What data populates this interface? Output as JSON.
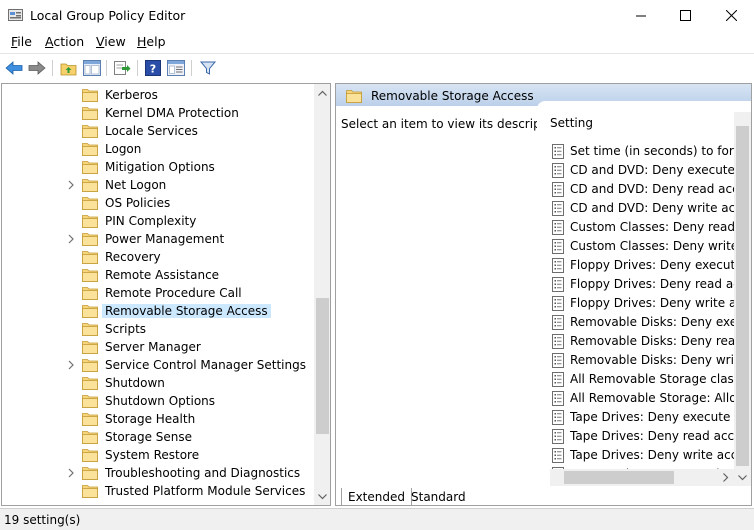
{
  "window": {
    "title": "Local Group Policy Editor",
    "controls": [
      "minimize",
      "maximize",
      "close"
    ]
  },
  "menu": {
    "items": [
      {
        "label": "File",
        "accel": "F"
      },
      {
        "label": "Action",
        "accel": "A"
      },
      {
        "label": "View",
        "accel": "V"
      },
      {
        "label": "Help",
        "accel": "H"
      }
    ]
  },
  "toolbar": {
    "icons": [
      "back-arrow-icon",
      "forward-arrow-icon",
      "up-folder-icon",
      "show-hide-tree-icon",
      "export-list-icon",
      "help-icon",
      "properties-icon",
      "filter-icon"
    ]
  },
  "tree": {
    "items": [
      {
        "label": "Kerberos",
        "expandable": false,
        "selected": false
      },
      {
        "label": "Kernel DMA Protection",
        "expandable": false,
        "selected": false
      },
      {
        "label": "Locale Services",
        "expandable": false,
        "selected": false
      },
      {
        "label": "Logon",
        "expandable": false,
        "selected": false
      },
      {
        "label": "Mitigation Options",
        "expandable": false,
        "selected": false
      },
      {
        "label": "Net Logon",
        "expandable": true,
        "selected": false
      },
      {
        "label": "OS Policies",
        "expandable": false,
        "selected": false
      },
      {
        "label": "PIN Complexity",
        "expandable": false,
        "selected": false
      },
      {
        "label": "Power Management",
        "expandable": true,
        "selected": false
      },
      {
        "label": "Recovery",
        "expandable": false,
        "selected": false
      },
      {
        "label": "Remote Assistance",
        "expandable": false,
        "selected": false
      },
      {
        "label": "Remote Procedure Call",
        "expandable": false,
        "selected": false
      },
      {
        "label": "Removable Storage Access",
        "expandable": false,
        "selected": true
      },
      {
        "label": "Scripts",
        "expandable": false,
        "selected": false
      },
      {
        "label": "Server Manager",
        "expandable": false,
        "selected": false
      },
      {
        "label": "Service Control Manager Settings",
        "expandable": true,
        "selected": false
      },
      {
        "label": "Shutdown",
        "expandable": false,
        "selected": false
      },
      {
        "label": "Shutdown Options",
        "expandable": false,
        "selected": false
      },
      {
        "label": "Storage Health",
        "expandable": false,
        "selected": false
      },
      {
        "label": "Storage Sense",
        "expandable": false,
        "selected": false
      },
      {
        "label": "System Restore",
        "expandable": false,
        "selected": false
      },
      {
        "label": "Troubleshooting and Diagnostics",
        "expandable": true,
        "selected": false
      },
      {
        "label": "Trusted Platform Module Services",
        "expandable": false,
        "selected": false
      }
    ]
  },
  "details": {
    "header_title": "Removable Storage Access",
    "description": "Select an item to view its description.",
    "column_header": "Setting",
    "settings": [
      "Set time (in seconds) to force reboot",
      "CD and DVD: Deny execute access",
      "CD and DVD: Deny read access",
      "CD and DVD: Deny write access",
      "Custom Classes: Deny read access",
      "Custom Classes: Deny write access",
      "Floppy Drives: Deny execute access",
      "Floppy Drives: Deny read access",
      "Floppy Drives: Deny write access",
      "Removable Disks: Deny execute access",
      "Removable Disks: Deny read access",
      "Removable Disks: Deny write access",
      "All Removable Storage classes: Deny all access",
      "All Removable Storage: Allow direct access in remote sessions",
      "Tape Drives: Deny execute access",
      "Tape Drives: Deny read access",
      "Tape Drives: Deny write access",
      "WPD Devices: Deny read access"
    ]
  },
  "tabs": {
    "items": [
      "Extended",
      "Standard"
    ],
    "active": "Extended"
  },
  "status": {
    "text": "19 setting(s)"
  }
}
